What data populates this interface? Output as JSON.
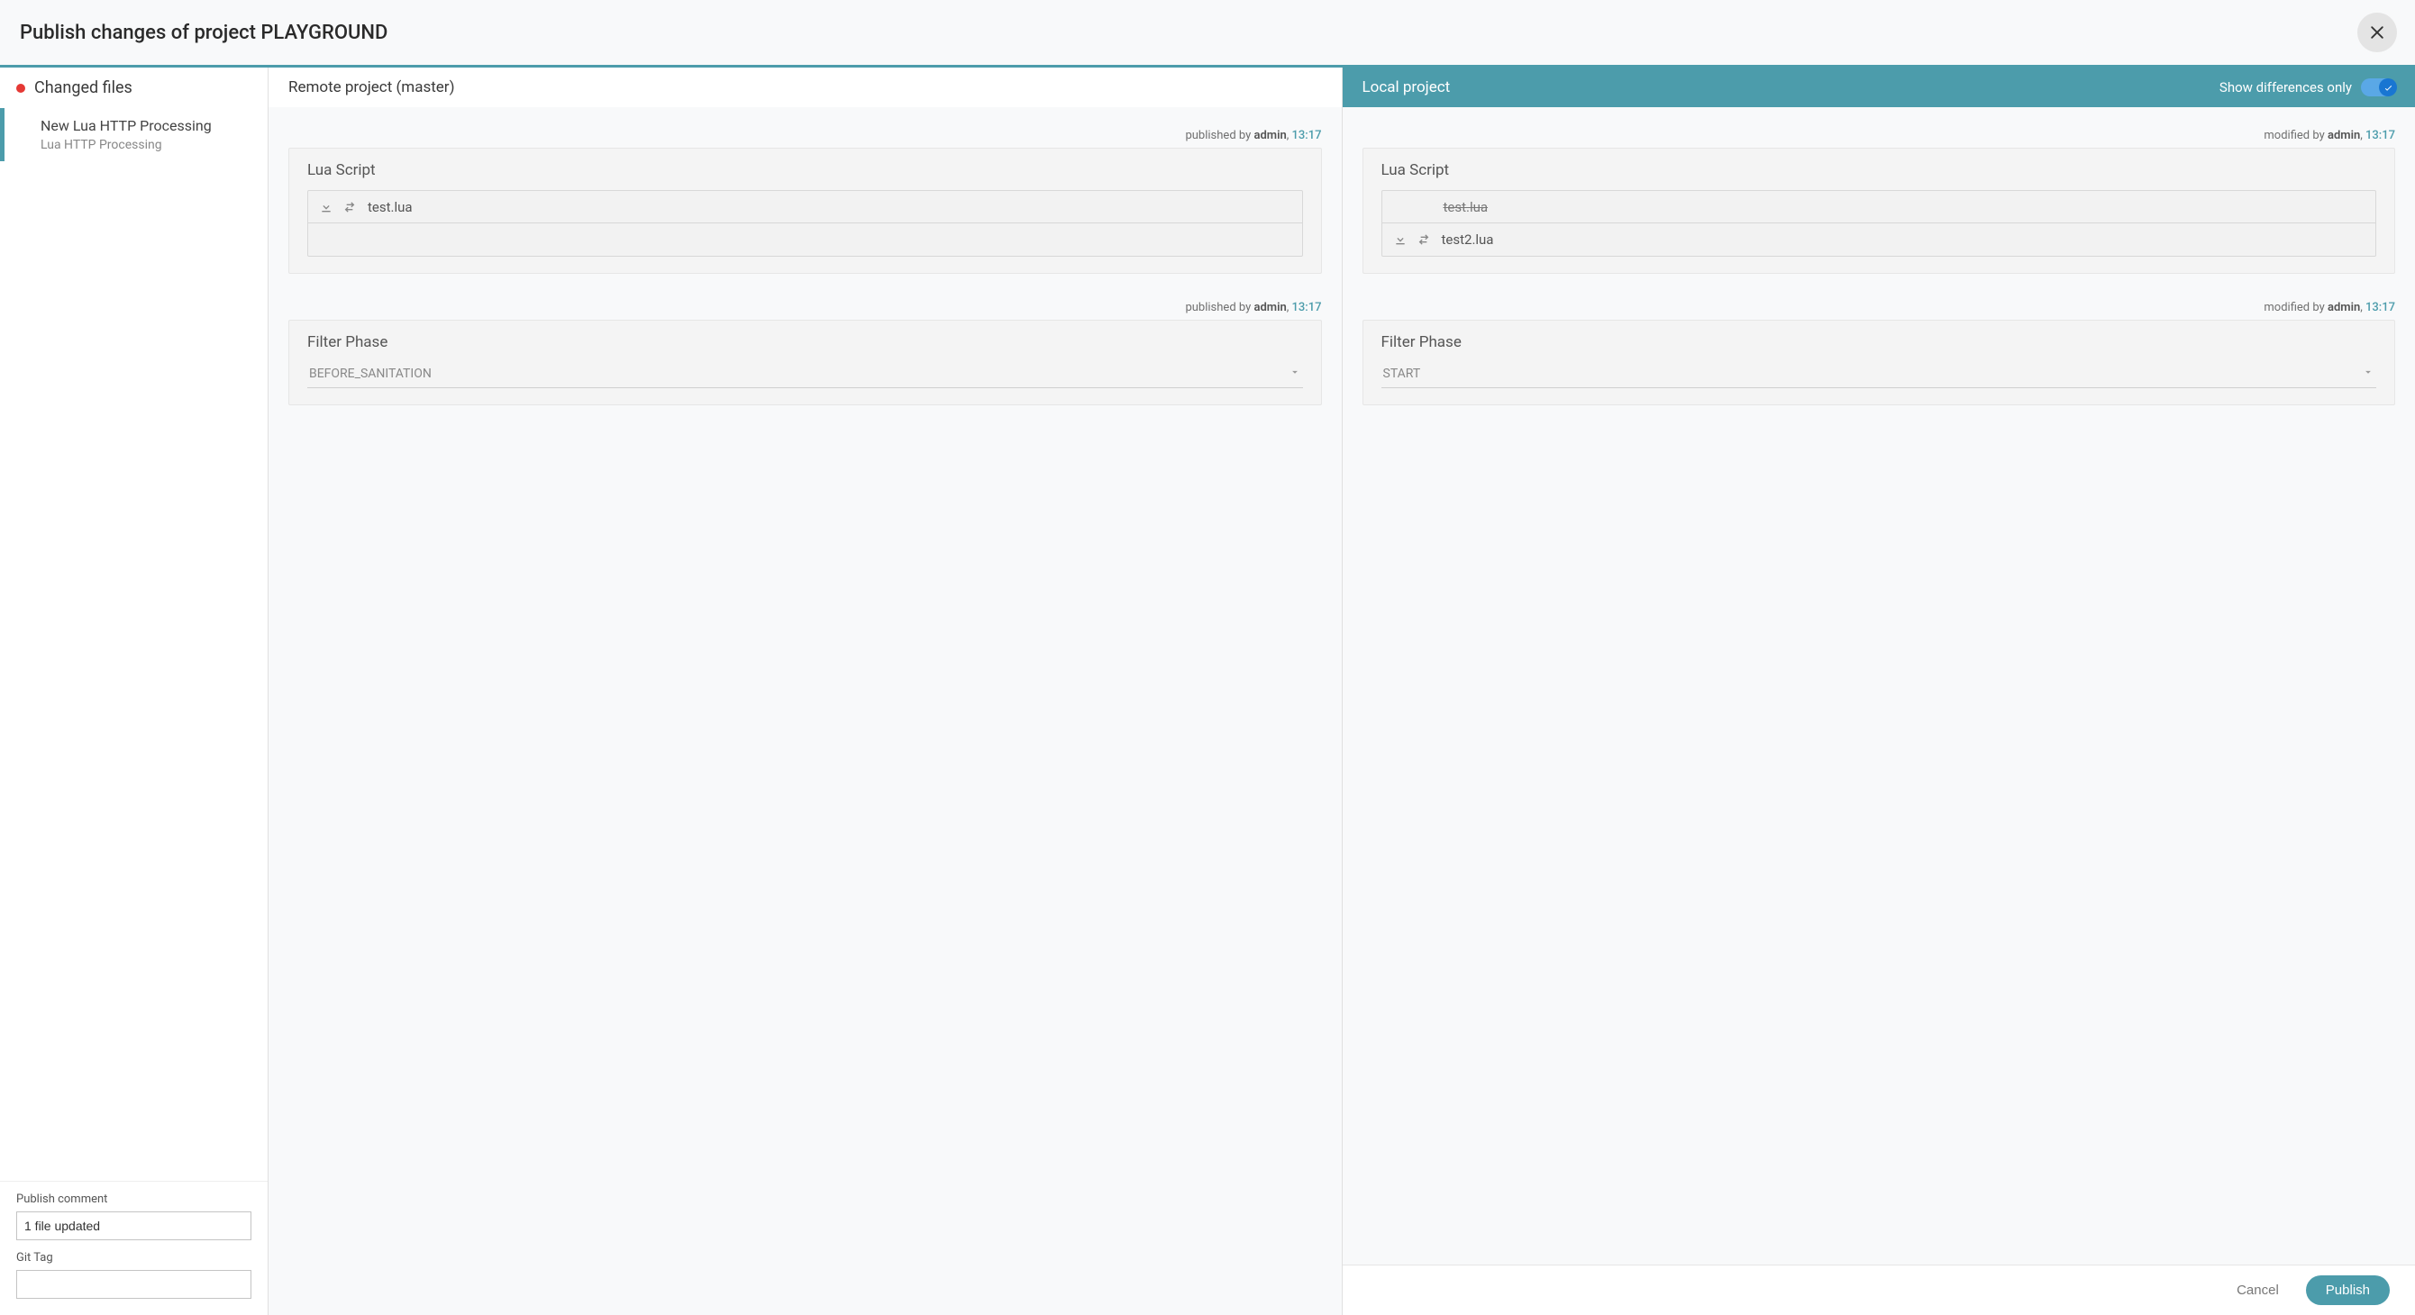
{
  "header": {
    "title": "Publish changes of project PLAYGROUND"
  },
  "sidebar": {
    "header": "Changed files",
    "file": {
      "name": "New Lua HTTP Processing",
      "sub": "Lua HTTP Processing"
    },
    "publish_comment_label": "Publish comment",
    "publish_comment_value": "1 file updated",
    "git_tag_label": "Git Tag",
    "git_tag_value": ""
  },
  "remote": {
    "title": "Remote project (master)",
    "blocks": [
      {
        "meta_prefix": "published by ",
        "meta_user": "admin",
        "meta_sep": ", ",
        "meta_time": "13:17",
        "card_title": "Lua Script",
        "rows": [
          {
            "name": "test.lua",
            "strike": false,
            "icons": true
          },
          {
            "name": "",
            "strike": false,
            "icons": false
          }
        ]
      },
      {
        "meta_prefix": "published by ",
        "meta_user": "admin",
        "meta_sep": ", ",
        "meta_time": "13:17",
        "card_title": "Filter Phase",
        "select_value": "BEFORE_SANITATION"
      }
    ]
  },
  "local": {
    "title": "Local project",
    "diff_toggle_label": "Show differences only",
    "blocks": [
      {
        "meta_prefix": "modified by ",
        "meta_user": "admin",
        "meta_sep": ", ",
        "meta_time": "13:17",
        "card_title": "Lua Script",
        "rows": [
          {
            "name": "test.lua",
            "strike": true,
            "icons": false
          },
          {
            "name": "test2.lua",
            "strike": false,
            "icons": true
          }
        ]
      },
      {
        "meta_prefix": "modified by ",
        "meta_user": "admin",
        "meta_sep": ", ",
        "meta_time": "13:17",
        "card_title": "Filter Phase",
        "select_value": "START"
      }
    ]
  },
  "footer": {
    "cancel": "Cancel",
    "publish": "Publish"
  }
}
